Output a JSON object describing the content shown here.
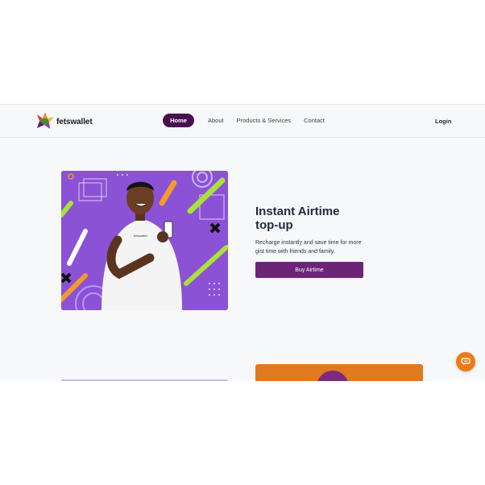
{
  "brand": {
    "name": "fetswallet"
  },
  "nav": {
    "items": [
      {
        "label": "Home",
        "active": true
      },
      {
        "label": "About"
      },
      {
        "label": "Products & Services"
      },
      {
        "label": "Contact"
      }
    ],
    "login_label": "Login"
  },
  "hero": {
    "title_line1": "Instant Airtime",
    "title_line2": "top-up",
    "description": "Recharge instantly and save time for more gist time with friends and family.",
    "cta_label": "Buy Airtime",
    "image_alt_icon": "person-with-phone-illustration",
    "shirt_text": "fetswallet"
  },
  "chat": {
    "icon": "chat-bubble-icon"
  },
  "colors": {
    "primary": "#4a0f4f",
    "cta": "#6c2479",
    "accent_orange": "#ef7b12",
    "hero_bg": "#8b52d6",
    "page_bg": "#f7f8fa"
  }
}
